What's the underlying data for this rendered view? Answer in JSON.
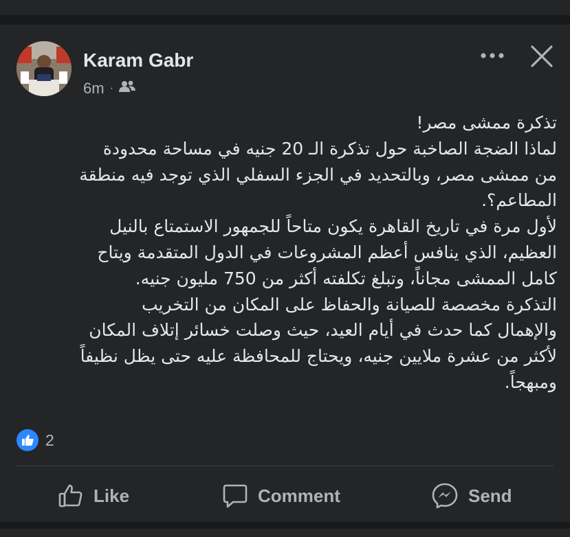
{
  "post": {
    "author": "Karam Gabr",
    "time": "6m",
    "separator": "·",
    "audience_icon": "friends-icon",
    "body_lines": [
      "تذكرة ممشى مصر!",
      "لماذا الضجة الصاخبة حول تذكرة الـ 20 جنيه في مساحة محدودة",
      "من ممشى مصر، وبالتحديد في الجزء السفلي الذي توجد فيه منطقة",
      "المطاعم؟.",
      "لأول مرة في تاريخ القاهرة يكون متاحاً للجمهور الاستمتاع بالنيل",
      "العظيم، الذي ينافس أعظم المشروعات في الدول المتقدمة ويتاح",
      "كامل الممشى مجاناً، وتبلغ تكلفته أكثر من 750 مليون جنيه.",
      "التذكرة مخصصة للصيانة والحفاظ على المكان من التخريب",
      "والإهمال كما حدث في أيام العيد، حيث وصلت خسائر إتلاف المكان",
      "لأكثر من عشرة ملايين جنيه، ويحتاج للمحافظة عليه حتى يظل نظيفاً",
      "ومبهجاً."
    ],
    "reaction_count": "2"
  },
  "actions": {
    "like": "Like",
    "comment": "Comment",
    "send": "Send"
  },
  "colors": {
    "background": "#18191a",
    "card": "#242526",
    "text_primary": "#e4e6eb",
    "text_secondary": "#b0b3b8",
    "like_blue": "#2d88ff"
  }
}
